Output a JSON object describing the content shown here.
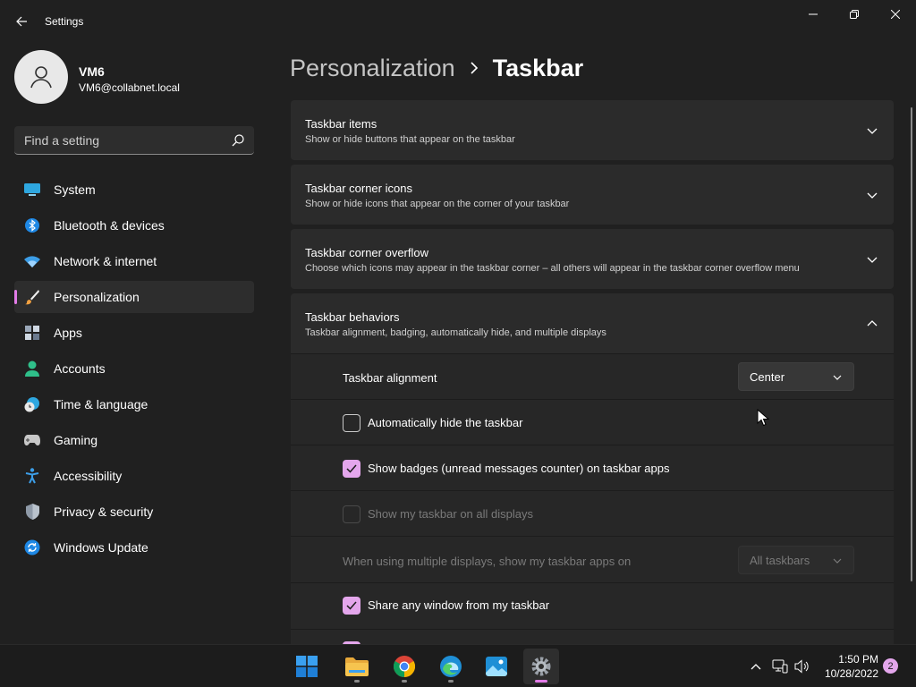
{
  "window": {
    "title": "Settings"
  },
  "profile": {
    "name": "VM6",
    "email": "VM6@collabnet.local"
  },
  "search": {
    "placeholder": "Find a setting"
  },
  "sidebar": {
    "items": [
      {
        "label": "System",
        "icon": "monitor-icon",
        "active": false
      },
      {
        "label": "Bluetooth & devices",
        "icon": "bluetooth-icon",
        "active": false
      },
      {
        "label": "Network & internet",
        "icon": "wifi-icon",
        "active": false
      },
      {
        "label": "Personalization",
        "icon": "paintbrush-icon",
        "active": true
      },
      {
        "label": "Apps",
        "icon": "apps-icon",
        "active": false
      },
      {
        "label": "Accounts",
        "icon": "person-icon",
        "active": false
      },
      {
        "label": "Time & language",
        "icon": "clock-globe-icon",
        "active": false
      },
      {
        "label": "Gaming",
        "icon": "gamepad-icon",
        "active": false
      },
      {
        "label": "Accessibility",
        "icon": "accessibility-icon",
        "active": false
      },
      {
        "label": "Privacy & security",
        "icon": "shield-icon",
        "active": false
      },
      {
        "label": "Windows Update",
        "icon": "update-icon",
        "active": false
      }
    ]
  },
  "breadcrumb": {
    "parent": "Personalization",
    "current": "Taskbar"
  },
  "cards": [
    {
      "title": "Taskbar items",
      "description": "Show or hide buttons that appear on the taskbar",
      "expanded": false
    },
    {
      "title": "Taskbar corner icons",
      "description": "Show or hide icons that appear on the corner of your taskbar",
      "expanded": false
    },
    {
      "title": "Taskbar corner overflow",
      "description": "Choose which icons may appear in the taskbar corner – all others will appear in the taskbar corner overflow menu",
      "expanded": false
    },
    {
      "title": "Taskbar behaviors",
      "description": "Taskbar alignment, badging, automatically hide, and multiple displays",
      "expanded": true
    }
  ],
  "behaviors": {
    "alignment": {
      "label": "Taskbar alignment",
      "value": "Center"
    },
    "auto_hide": {
      "label": "Automatically hide the taskbar",
      "checked": false
    },
    "badges": {
      "label": "Show badges (unread messages counter) on taskbar apps",
      "checked": true
    },
    "all_displays": {
      "label": "Show my taskbar on all displays",
      "checked": false,
      "disabled": true
    },
    "multi_display": {
      "label": "When using multiple displays, show my taskbar apps on",
      "value": "All taskbars",
      "disabled": true
    },
    "share_window": {
      "label": "Share any window from my taskbar",
      "checked": true
    }
  },
  "taskbar": {
    "apps": [
      {
        "name": "Start",
        "icon": "windows-logo-icon"
      },
      {
        "name": "File Explorer",
        "icon": "folder-icon"
      },
      {
        "name": "Chrome",
        "icon": "chrome-icon"
      },
      {
        "name": "Edge",
        "icon": "edge-icon"
      },
      {
        "name": "Photos",
        "icon": "photos-icon"
      },
      {
        "name": "Settings",
        "icon": "settings-gear-icon"
      }
    ],
    "time": "1:50 PM",
    "date": "10/28/2022",
    "notifications": "2"
  },
  "colors": {
    "accent": "#e27be7",
    "checkbox_fill": "#e4a6ec",
    "background": "#202020",
    "card": "#2b2b2b"
  }
}
